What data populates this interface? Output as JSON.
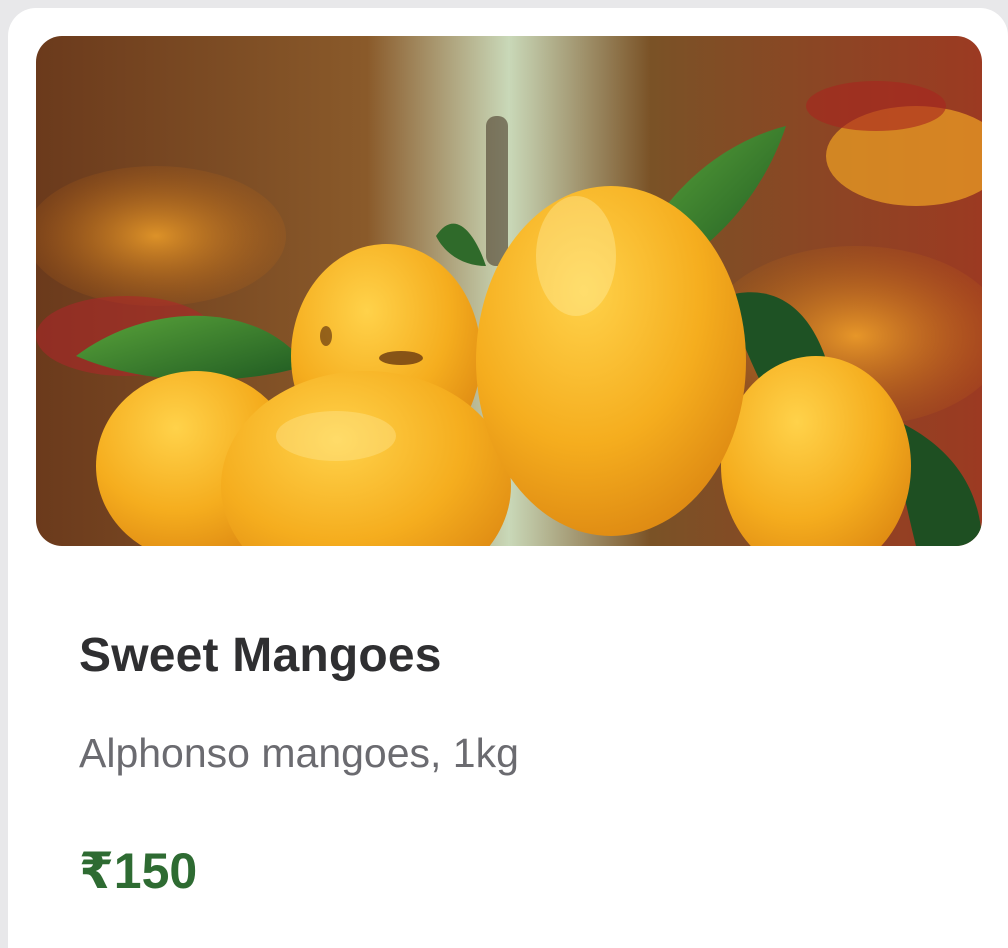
{
  "product": {
    "image_subject": "mangoes-photo",
    "name": "Sweet Mangoes",
    "description": "Alphonso mangoes, 1kg",
    "price": "₹150",
    "price_color": "#2e6b32",
    "title_color": "#2f2f31",
    "description_color": "#6b6b70"
  }
}
